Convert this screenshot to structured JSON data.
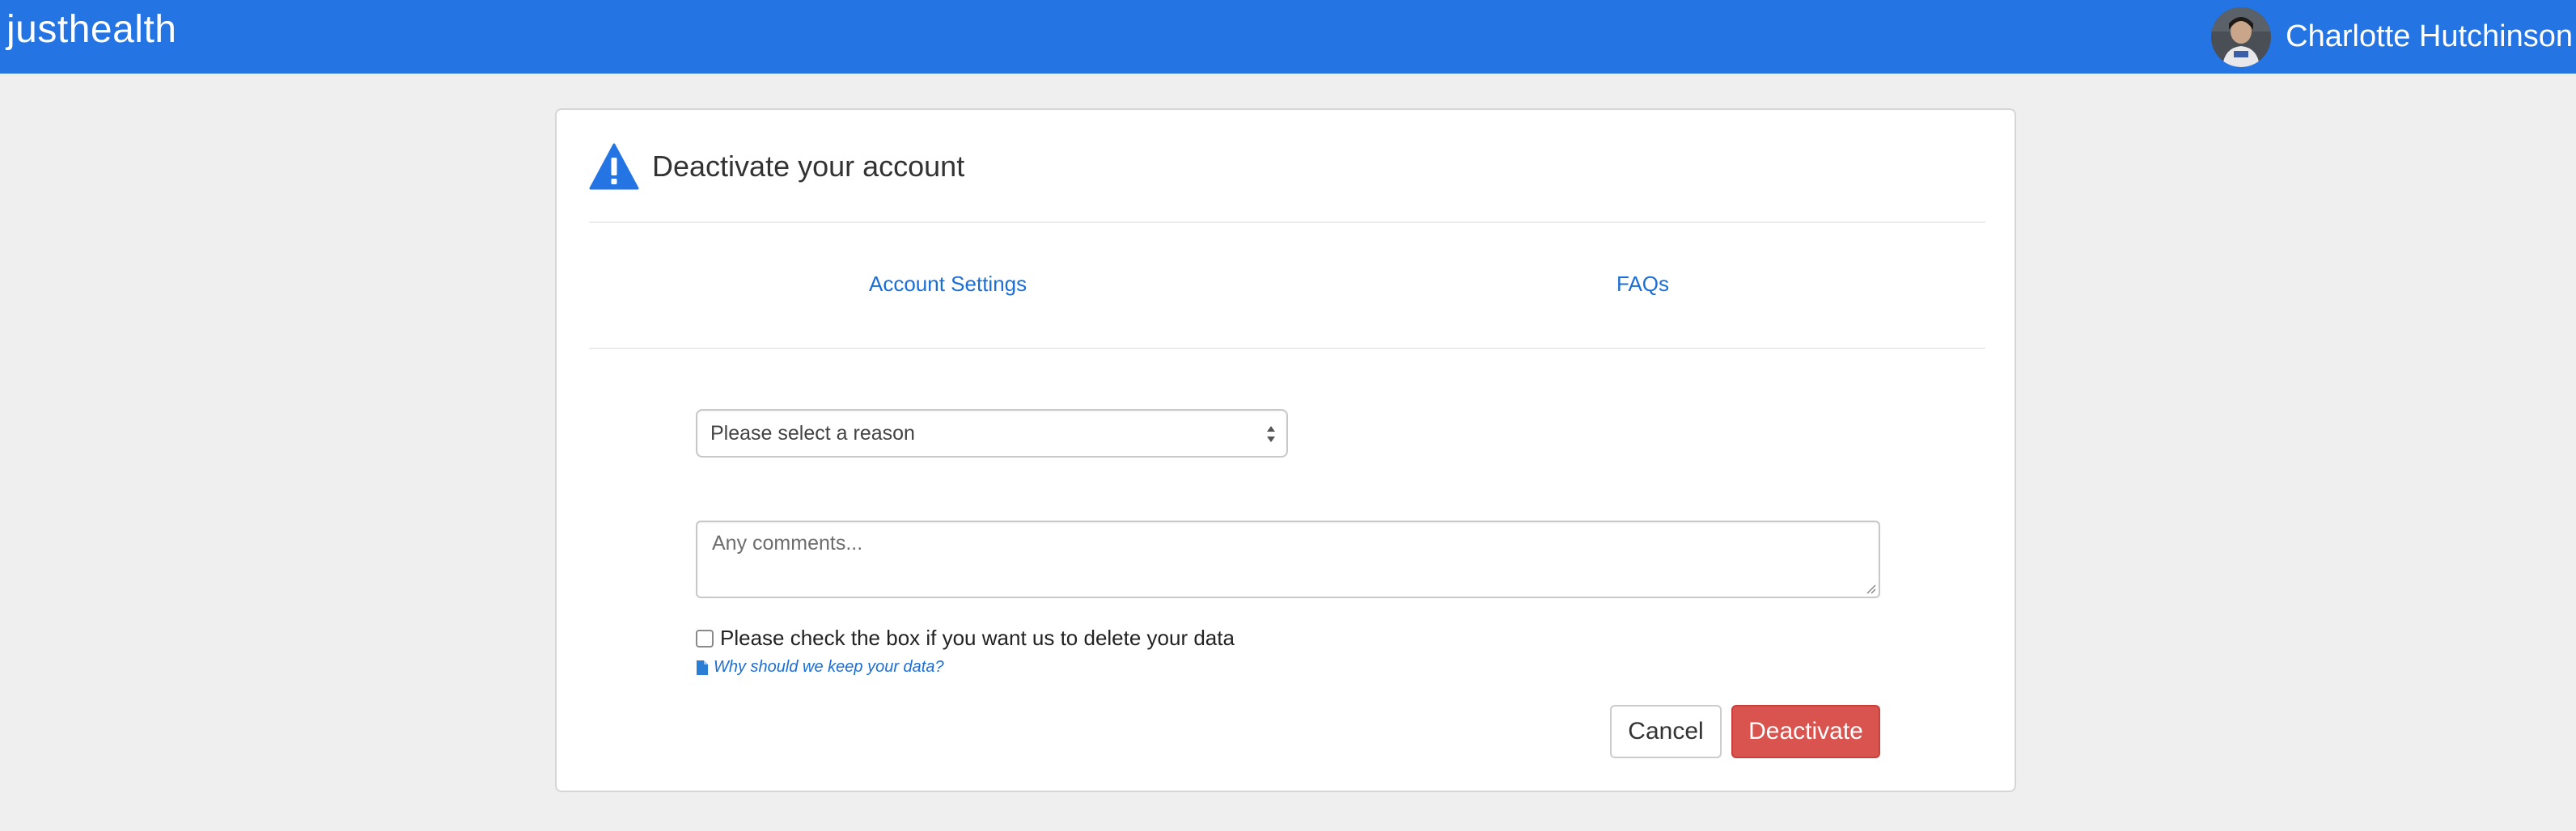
{
  "navbar": {
    "brand": "justhealth",
    "user_name": "Charlotte Hutchinson",
    "color": "#2474e4"
  },
  "panel": {
    "title": "Deactivate your account",
    "title_icon": "warning-triangle-icon",
    "tabs": [
      {
        "label": "Account Settings"
      },
      {
        "label": "FAQs"
      }
    ]
  },
  "form": {
    "reason_select": {
      "selected": "Please select a reason"
    },
    "comments": {
      "placeholder": "Any comments..."
    },
    "delete_data_checkbox": {
      "label": "Please check the box if you want us to delete your data",
      "checked": false
    },
    "help_link": {
      "label": "Why should we keep your data?",
      "icon": "document-icon"
    },
    "cancel_label": "Cancel",
    "deactivate_label": "Deactivate"
  },
  "colors": {
    "link": "#1b6ed6",
    "danger": "#d9534f",
    "background": "#efefef"
  }
}
